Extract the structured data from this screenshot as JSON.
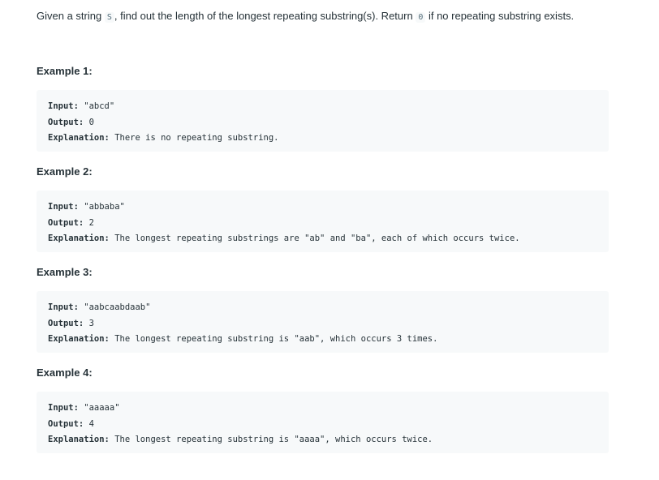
{
  "problem": {
    "intro_before": "Given a string ",
    "intro_var": "S",
    "intro_middle": ", find out the length of the longest repeating substring(s). Return ",
    "intro_zero": "0",
    "intro_after": " if no repeating substring exists."
  },
  "examples": [
    {
      "heading": "Example 1:",
      "input_label": "Input:",
      "input_value": "\"abcd\"",
      "output_label": "Output:",
      "output_value": "0",
      "explanation_label": "Explanation:",
      "explanation_value": "There is no repeating substring."
    },
    {
      "heading": "Example 2:",
      "input_label": "Input:",
      "input_value": "\"abbaba\"",
      "output_label": "Output:",
      "output_value": "2",
      "explanation_label": "Explanation:",
      "explanation_value": "The longest repeating substrings are \"ab\" and \"ba\", each of which occurs twice."
    },
    {
      "heading": "Example 3:",
      "input_label": "Input:",
      "input_value": "\"aabcaabdaab\"",
      "output_label": "Output:",
      "output_value": "3",
      "explanation_label": "Explanation:",
      "explanation_value": "The longest repeating substring is \"aab\", which occurs 3 times."
    },
    {
      "heading": "Example 4:",
      "input_label": "Input:",
      "input_value": "\"aaaaa\"",
      "output_label": "Output:",
      "output_value": "4",
      "explanation_label": "Explanation:",
      "explanation_value": "The longest repeating substring is \"aaaa\", which occurs twice."
    }
  ]
}
